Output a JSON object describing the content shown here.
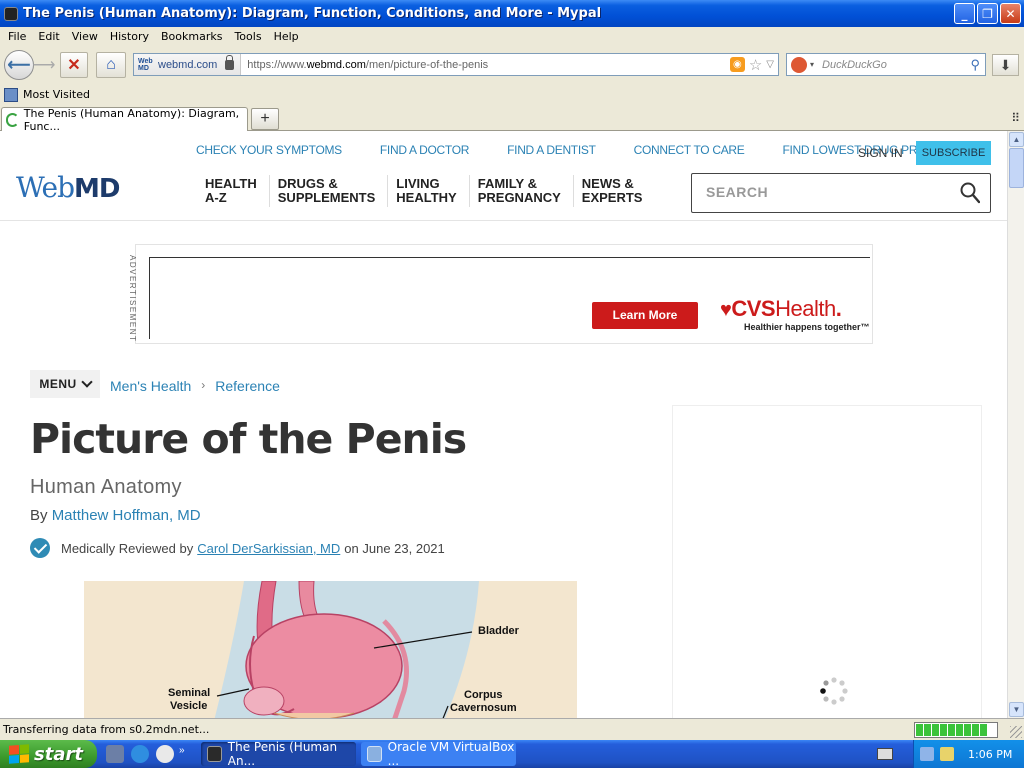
{
  "window": {
    "title": "The Penis (Human Anatomy): Diagram, Function, Conditions, and More - Mypal",
    "minimize": "_",
    "restore": "❐",
    "close": "✕"
  },
  "menubar": [
    "File",
    "Edit",
    "View",
    "History",
    "Bookmarks",
    "Tools",
    "Help"
  ],
  "navbar": {
    "identity_domain": "webmd.com",
    "url_prefix": "https://www.",
    "url_domain": "webmd.com",
    "url_path": "/men/picture-of-the-penis",
    "search_engine": "DuckDuckGo"
  },
  "bookmarks": {
    "most_visited": "Most Visited"
  },
  "tab": {
    "title": "The Penis (Human Anatomy): Diagram, Func..."
  },
  "webmd": {
    "top_links": [
      "CHECK YOUR SYMPTOMS",
      "FIND A DOCTOR",
      "FIND A DENTIST",
      "CONNECT TO CARE",
      "FIND LOWEST DRUG PRICES"
    ],
    "sign_in": "SIGN IN",
    "subscribe": "SUBSCRIBE",
    "logo_web": "Web",
    "logo_md": "MD",
    "main_nav": [
      "HEALTH\nA-Z",
      "DRUGS &\nSUPPLEMENTS",
      "LIVING\nHEALTHY",
      "FAMILY &\nPREGNANCY",
      "NEWS &\nEXPERTS"
    ],
    "search_placeholder": "SEARCH"
  },
  "ad": {
    "label": "ADVERTISEMENT",
    "button": "Learn More",
    "brand_cvs": "CVS",
    "brand_health": "Health",
    "brand_suffix": ".",
    "tagline": "Healthier happens together™"
  },
  "breadcrumb": {
    "menu": "MENU",
    "items": [
      "Men's Health",
      "Reference"
    ],
    "separator": "›"
  },
  "article": {
    "title": "Picture of the Penis",
    "subtitle": "Human Anatomy",
    "by_prefix": "By ",
    "author": "Matthew Hoffman, MD",
    "reviewed_prefix": "Medically Reviewed by",
    "reviewer": "Carol DerSarkissian, MD",
    "reviewed_date": "on June 23, 2021"
  },
  "anatomy_labels": {
    "bladder": "Bladder",
    "seminal_1": "Seminal",
    "seminal_2": "Vesicle",
    "corpus_1": "Corpus",
    "corpus_2": "Cavernosum"
  },
  "status": {
    "text": "Transferring data from s0.2mdn.net...",
    "progress": 0.9
  },
  "taskbar": {
    "start": "start",
    "tasks": [
      "The Penis (Human An...",
      "Oracle VM VirtualBox ..."
    ],
    "clock": "1:06 PM"
  }
}
